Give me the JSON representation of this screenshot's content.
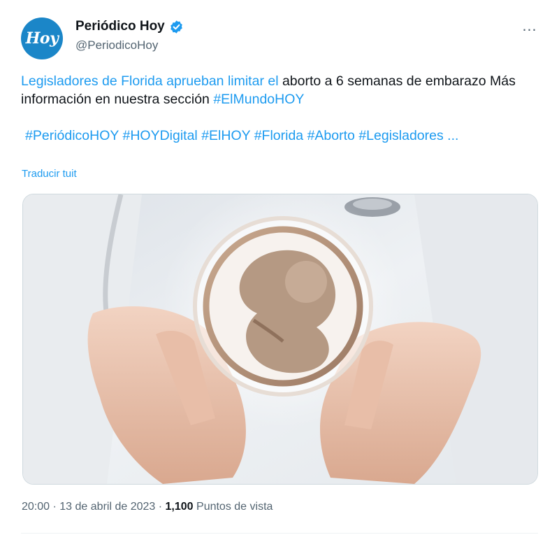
{
  "author": {
    "avatar_text": "Hoy",
    "display_name": "Periódico Hoy",
    "handle": "@PeriodicoHoy",
    "verified_icon": "verified-badge-icon",
    "accent_color": "#1d9bf0",
    "avatar_color": "#1b86c8"
  },
  "more_icon": "…",
  "text": {
    "link_part": "Legisladores de Florida aprueban limitar el",
    "plain_part": " aborto a 6 semanas de embarazo Más información en nuestra sección ",
    "hashtag_inline": "#ElMundoHOY"
  },
  "hashtags": [
    "#PeriódicoHOY",
    "#HOYDigital",
    "#ElHOY",
    "#Florida",
    "#Aborto",
    "#Legisladores ..."
  ],
  "translate_label": "Traducir tuit",
  "media": {
    "description_icon": "fetus-in-hands-image"
  },
  "meta": {
    "time": "20:00",
    "separator": "·",
    "date": "13 de abril de 2023",
    "views_count": "1,100",
    "views_label": "Puntos de vista"
  }
}
